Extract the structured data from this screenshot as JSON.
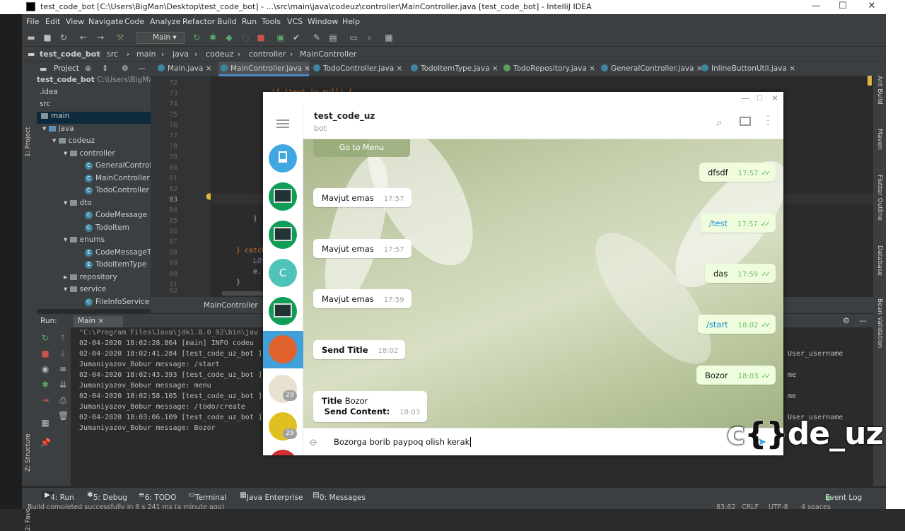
{
  "window": {
    "title": "test_code_bot [C:\\Users\\BigMan\\Desktop\\test_code_bot] - ...\\src\\main\\java\\codeuz\\controller\\MainController.java [test_code_bot] - IntelliJ IDEA",
    "min": "—",
    "max": "☐",
    "close": "✕"
  },
  "menu": [
    "File",
    "Edit",
    "View",
    "Navigate",
    "Code",
    "Analyze",
    "Refactor",
    "Build",
    "Run",
    "Tools",
    "VCS",
    "Window",
    "Help"
  ],
  "toolbar": {
    "run_config": "Main"
  },
  "breadcrumbs": [
    "test_code_bot",
    "src",
    "main",
    "java",
    "codeuz",
    "controller",
    "MainController"
  ],
  "project": {
    "header": "Project",
    "root": "test_code_bot",
    "root_path": "C:\\Users\\BigMan\\Des",
    "items": [
      {
        "label": ".idea",
        "kind": "folder"
      },
      {
        "label": "src",
        "kind": "folder"
      },
      {
        "label": "main",
        "kind": "folder"
      },
      {
        "label": "java",
        "kind": "folder"
      },
      {
        "label": "codeuz",
        "kind": "folder"
      },
      {
        "label": "controller",
        "kind": "folder"
      },
      {
        "label": "GeneralController",
        "kind": "class"
      },
      {
        "label": "MainController",
        "kind": "class"
      },
      {
        "label": "TodoController",
        "kind": "class"
      },
      {
        "label": "dto",
        "kind": "folder"
      },
      {
        "label": "CodeMessage",
        "kind": "class"
      },
      {
        "label": "TodoItem",
        "kind": "class"
      },
      {
        "label": "enums",
        "kind": "folder"
      },
      {
        "label": "CodeMessageTyp",
        "kind": "class"
      },
      {
        "label": "TodoItemType",
        "kind": "class"
      },
      {
        "label": "repository",
        "kind": "folder"
      },
      {
        "label": "service",
        "kind": "folder"
      },
      {
        "label": "FileInfoService",
        "kind": "class"
      }
    ]
  },
  "tabs": [
    "Main.java",
    "MainController.java",
    "TodoController.java",
    "TodoItemType.java",
    "TodoRepository.java",
    "GeneralController.java",
    "InlineButtonUtil.java"
  ],
  "line_numbers": [
    "72",
    "73",
    "74",
    "75",
    "76",
    "77",
    "78",
    "79",
    "80",
    "81",
    "82",
    "83",
    "84",
    "85",
    "86",
    "87",
    "88",
    "89",
    "90",
    "91",
    "92"
  ],
  "code_fragments": {
    "top": "if (text != null) {",
    "brace": "}",
    "catch": "} catch",
    "lo": "LO",
    "e": "e.",
    "close": "}"
  },
  "editor_footer": "MainController",
  "left_strip": [
    "1: Project",
    "Z: Structure",
    "2: Favorites"
  ],
  "right_strip": [
    "Ant Build",
    "Maven",
    "Flutter Outline",
    "Database",
    "Bean Validation"
  ],
  "run": {
    "label": "Run:",
    "config": "Main",
    "lines": [
      "\"C:\\Program Files\\Java\\jdk1.8.0_92\\bin\\jav",
      "02-04-2020 18:02:28.864 [main] INFO  codeu",
      "02-04-2020 18:02:41.284 [test_code_uz_bot ]",
      " Jumaniyazov_Bobur  message: /start",
      "02-04-2020 18:02:43.393 [test_code_uz_bot ]",
      " Jumaniyazov_Bobur  message: menu",
      "02-04-2020 18:02:58.105 [test_code_uz_bot ]",
      " Jumaniyazov_Bobur  message: /todo/create",
      "02-04-2020 18:03:06.109 [test_code_uz_bot ]",
      " Jumaniyazov_Bobur  message: Bozor"
    ],
    "right_fragments": [
      "User_username",
      "me",
      "me",
      "User_username"
    ]
  },
  "bottom_tools": [
    "4: Run",
    "5: Debug",
    "6: TODO",
    "Terminal",
    "Java Enterprise",
    "0: Messages"
  ],
  "event_log": "Event Log",
  "status": {
    "message": "Build completed successfully in 6 s 241 ms (a minute ago)",
    "position": "83:62",
    "line_sep": "CRLF",
    "encoding": "UTF-8",
    "indent": "4 spaces"
  },
  "telegram": {
    "chat_title": "test_code_uz",
    "chat_subtitle": "bot",
    "goto_menu": "Go to Menu",
    "avatar_letter": "C",
    "badges": [
      "29",
      "29"
    ],
    "messages": [
      {
        "dir": "out",
        "text": "dfsdf",
        "time": "17:57"
      },
      {
        "dir": "in",
        "text": "Mavjut emas",
        "time": "17:57"
      },
      {
        "dir": "out",
        "text": "/test",
        "time": "17:57"
      },
      {
        "dir": "in",
        "text": "Mavjut emas",
        "time": "17:57"
      },
      {
        "dir": "out",
        "text": "das",
        "time": "17:59"
      },
      {
        "dir": "in",
        "text": "Mavjut emas",
        "time": "17:59"
      },
      {
        "dir": "out",
        "text": "/start",
        "time": "18:02"
      },
      {
        "dir": "in",
        "text": "Send Title",
        "time": "18:02"
      },
      {
        "dir": "out",
        "text": "Bozor",
        "time": "18:03"
      },
      {
        "dir": "in",
        "text": "Title",
        "text2": "Bozor",
        "text3": "Send Content:",
        "time": "18:03"
      }
    ],
    "input_value": "Bozorga borib paypoq olish kerak",
    "colors": {
      "accent": "#40a7e3",
      "out_bubble": "#effdde",
      "time_out": "#6cbb66"
    }
  },
  "watermark": {
    "c": "c",
    "braces": "{}",
    "rest": "de_uz"
  }
}
